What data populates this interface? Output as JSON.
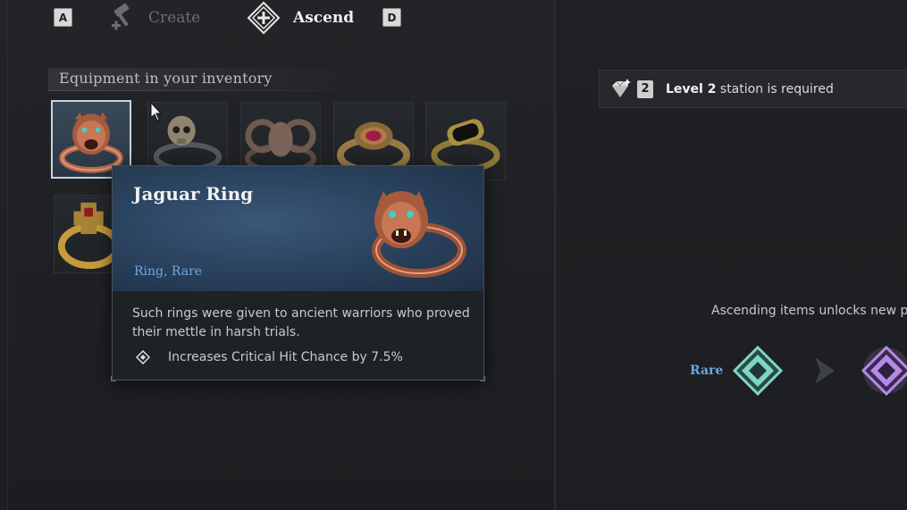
{
  "tabs": {
    "left_key": "A",
    "create_label": "Create",
    "ascend_label": "Ascend",
    "right_key": "D"
  },
  "inventory": {
    "title": "Equipment in your inventory",
    "items": [
      {
        "name": "Jaguar Ring",
        "icon": "jaguar-ring-icon",
        "selected": true
      },
      {
        "name": "Skull Ring",
        "icon": "skull-ring-icon",
        "selected": false
      },
      {
        "name": "Ram Ring",
        "icon": "ram-ring-icon",
        "selected": false
      },
      {
        "name": "Ruby Ring",
        "icon": "ruby-ring-icon",
        "selected": false
      },
      {
        "name": "Onyx Ring",
        "icon": "onyx-ring-icon",
        "selected": false
      },
      {
        "name": "Cross Ring",
        "icon": "cross-ring-icon",
        "selected": false
      }
    ]
  },
  "tooltip": {
    "name": "Jaguar Ring",
    "type": "Ring, Rare",
    "description": "Such rings were given to ancient warriors who proved their mettle in harsh trials.",
    "stat": "Increases Critical Hit Chance by 7.5%"
  },
  "requirement": {
    "level_badge": "2",
    "level_text": "Level 2",
    "suffix": " station is required"
  },
  "ascension": {
    "hint": "Ascending items unlocks new pe",
    "current_rarity": "Rare"
  },
  "colors": {
    "rare": "#6ea6e0",
    "rare_gem": "#7fd6c4",
    "epic_gem": "#b58ae6",
    "background": "#1d1f22"
  }
}
